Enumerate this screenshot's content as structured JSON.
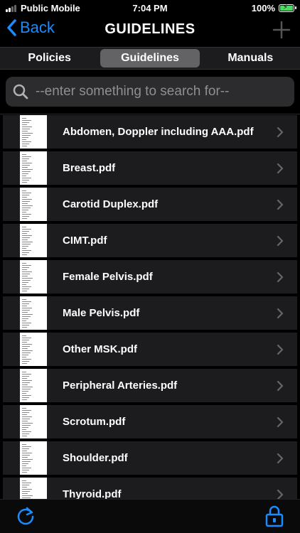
{
  "status_bar": {
    "carrier": "Public Mobile",
    "time": "7:04 PM",
    "battery_percent": "100%",
    "battery_level": 1.0,
    "signal_bars": 2
  },
  "nav": {
    "back_label": "Back",
    "title": "GUIDELINES",
    "accent_color": "#1a8cff"
  },
  "tabs": [
    {
      "label": "Policies",
      "active": false
    },
    {
      "label": "Guidelines",
      "active": true
    },
    {
      "label": "Manuals",
      "active": false
    }
  ],
  "search": {
    "placeholder": "--enter something to search for--",
    "value": ""
  },
  "files": [
    {
      "name": "Abdomen, Doppler including AAA.pdf"
    },
    {
      "name": "Breast.pdf"
    },
    {
      "name": "Carotid Duplex.pdf"
    },
    {
      "name": "CIMT.pdf"
    },
    {
      "name": "Female Pelvis.pdf"
    },
    {
      "name": "Male Pelvis.pdf"
    },
    {
      "name": "Other MSK.pdf"
    },
    {
      "name": "Peripheral Arteries.pdf"
    },
    {
      "name": "Scrotum.pdf"
    },
    {
      "name": "Shoulder.pdf"
    },
    {
      "name": "Thyroid.pdf"
    }
  ],
  "toolbar": {
    "left_icon": "refresh-icon",
    "right_icon": "lock-icon"
  }
}
